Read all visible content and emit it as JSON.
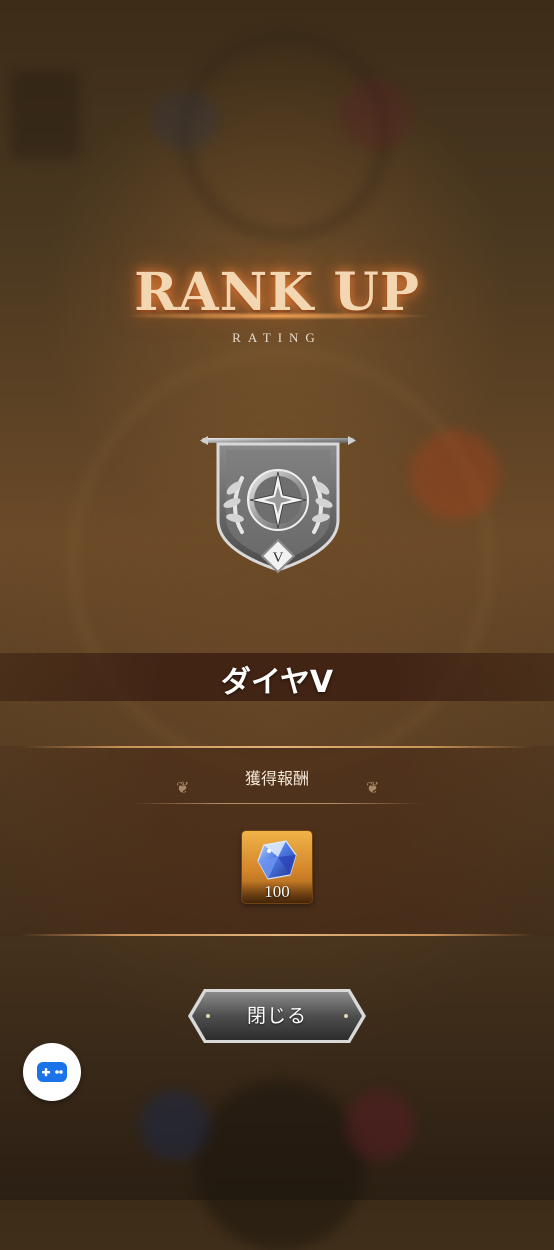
{
  "header": {
    "title": "RANK UP",
    "subtitle": "RATING"
  },
  "rank": {
    "emblem_letter": "V",
    "name": "ダイヤV"
  },
  "reward": {
    "label": "獲得報酬",
    "items": [
      {
        "icon": "diamond-gem-icon",
        "count": "100"
      }
    ]
  },
  "actions": {
    "close_label": "閉じる"
  },
  "overlay": {
    "gamepad_icon": "gamepad-icon"
  },
  "colors": {
    "title_glow": "#ff8c3c",
    "accent_gold": "#e3b27a",
    "reward_tile": "#d3862a",
    "gem": "#3a63d8"
  }
}
